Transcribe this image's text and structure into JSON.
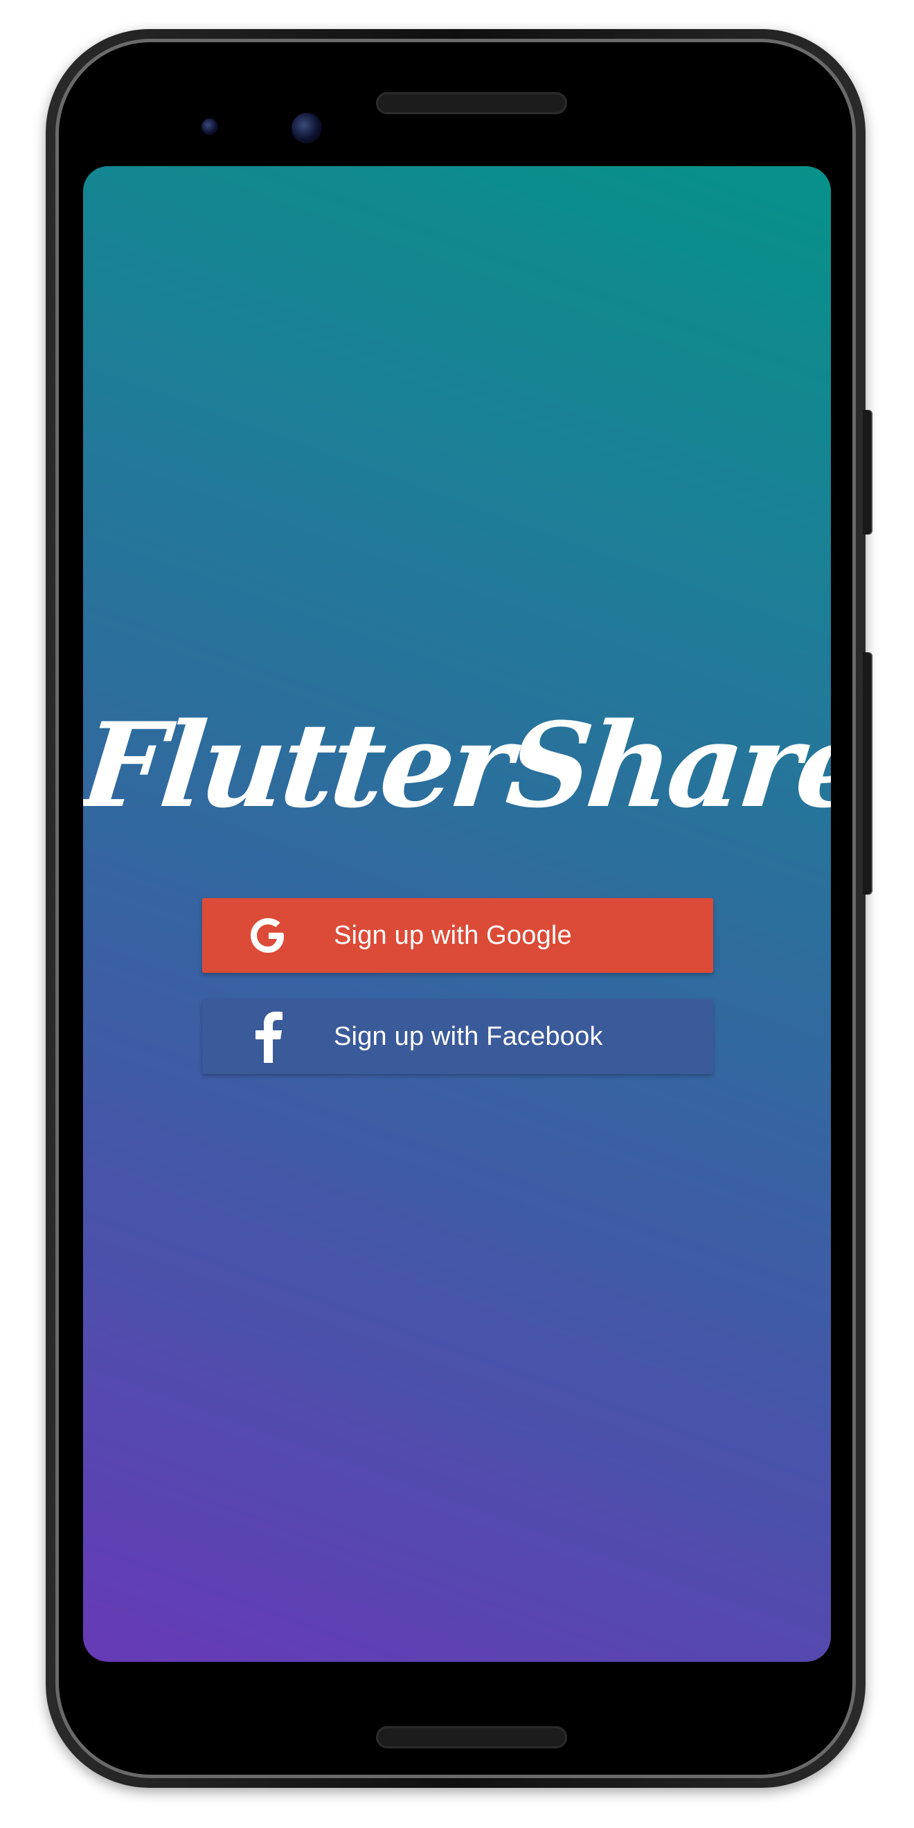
{
  "app": {
    "title": "FlutterShare"
  },
  "buttons": {
    "google": {
      "label": "Sign up with Google",
      "icon": "google-g-icon",
      "color": "#dc4b37"
    },
    "facebook": {
      "label": "Sign up with Facebook",
      "icon": "facebook-f-icon",
      "color": "#3b5a9a"
    }
  },
  "theme": {
    "gradient_top": "#069289",
    "gradient_bottom": "#673ab7"
  }
}
